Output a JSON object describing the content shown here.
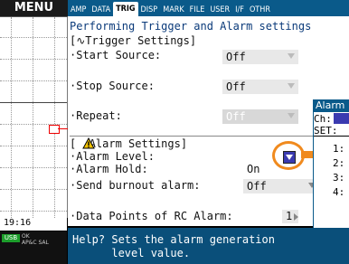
{
  "sidebar": {
    "menu_label": "MENU",
    "clock": "19:16",
    "usb_badge": "USB",
    "info_top": "OK",
    "info_bottom": "AP&C SAL"
  },
  "tabs": [
    {
      "label": "AMP",
      "active": false
    },
    {
      "label": "DATA",
      "active": false
    },
    {
      "label": "TRIG",
      "active": true
    },
    {
      "label": "DISP",
      "active": false
    },
    {
      "label": "MARK",
      "active": false
    },
    {
      "label": "FILE",
      "active": false
    },
    {
      "label": "USER",
      "active": false
    },
    {
      "label": "I/F",
      "active": false
    },
    {
      "label": "OTHR",
      "active": false
    }
  ],
  "panel": {
    "title": "Performing Trigger and Alarm settings",
    "trigger_header": "[∿Trigger Settings]",
    "start_source_label": "·Start Source:",
    "start_source_value": "Off",
    "stop_source_label": "·Stop Source:",
    "stop_source_value": "Off",
    "repeat_label": "·Repeat:",
    "repeat_value": "Off",
    "alarm_header": "[  Alarm Settings]",
    "alarm_level_label": "·Alarm Level:",
    "alarm_hold_label": "·Alarm Hold:",
    "alarm_hold_value": "On",
    "burnout_label": "·Send burnout alarm:",
    "burnout_value": "Off",
    "rc_points_label": "·Data Points of RC Alarm:",
    "rc_points_value": "1"
  },
  "popup": {
    "title": "Alarm",
    "ch_label": "Ch:",
    "set_label": "SET:",
    "rows": [
      "1:",
      "2:",
      "3:",
      "4:"
    ]
  },
  "help": {
    "line1": "Help? Sets the alarm generation",
    "line2": "      level value."
  },
  "colors": {
    "tab_bar": "#0a5a8a",
    "help_bar": "#0a4f7a",
    "highlight": "#f08a1e",
    "accent_button": "#3a3ab0",
    "title_text": "#0a3a7a"
  }
}
